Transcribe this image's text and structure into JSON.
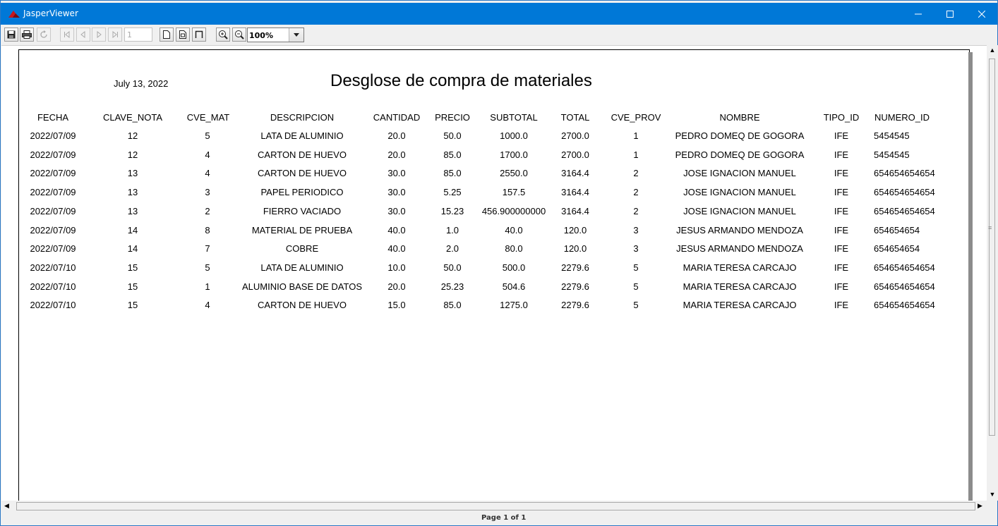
{
  "window": {
    "title": "JasperViewer"
  },
  "toolbar": {
    "page_number": "1",
    "zoom": "100%"
  },
  "report": {
    "date": "July 13, 2022",
    "title": "Desglose de compra de materiales",
    "headers": [
      "FECHA",
      "CLAVE_NOTA",
      "CVE_MAT",
      "DESCRIPCION",
      "CANTIDAD",
      "PRECIO",
      "SUBTOTAL",
      "TOTAL",
      "CVE_PROV",
      "NOMBRE",
      "TIPO_ID",
      "NUMERO_ID"
    ],
    "rows": [
      [
        "2022/07/09",
        "12",
        "5",
        "LATA DE ALUMINIO",
        "20.0",
        "50.0",
        "1000.0",
        "2700.0",
        "1",
        "PEDRO DOMEQ DE GOGORA",
        "IFE",
        "5454545"
      ],
      [
        "2022/07/09",
        "12",
        "4",
        "CARTON DE HUEVO",
        "20.0",
        "85.0",
        "1700.0",
        "2700.0",
        "1",
        "PEDRO DOMEQ DE GOGORA",
        "IFE",
        "5454545"
      ],
      [
        "2022/07/09",
        "13",
        "4",
        "CARTON DE HUEVO",
        "30.0",
        "85.0",
        "2550.0",
        "3164.4",
        "2",
        "JOSE IGNACION MANUEL",
        "IFE",
        "654654654654"
      ],
      [
        "2022/07/09",
        "13",
        "3",
        "PAPEL PERIODICO",
        "30.0",
        "5.25",
        "157.5",
        "3164.4",
        "2",
        "JOSE IGNACION MANUEL",
        "IFE",
        "654654654654"
      ],
      [
        "2022/07/09",
        "13",
        "2",
        "FIERRO VACIADO",
        "30.0",
        "15.23",
        "456.900000000",
        "3164.4",
        "2",
        "JOSE IGNACION MANUEL",
        "IFE",
        "654654654654"
      ],
      [
        "2022/07/09",
        "14",
        "8",
        "MATERIAL DE PRUEBA",
        "40.0",
        "1.0",
        "40.0",
        "120.0",
        "3",
        "JESUS ARMANDO MENDOZA",
        "IFE",
        "654654654"
      ],
      [
        "2022/07/09",
        "14",
        "7",
        "COBRE",
        "40.0",
        "2.0",
        "80.0",
        "120.0",
        "3",
        "JESUS ARMANDO MENDOZA",
        "IFE",
        "654654654"
      ],
      [
        "2022/07/10",
        "15",
        "5",
        "LATA DE ALUMINIO",
        "10.0",
        "50.0",
        "500.0",
        "2279.6",
        "5",
        "MARIA TERESA CARCAJO",
        "IFE",
        "654654654654"
      ],
      [
        "2022/07/10",
        "15",
        "1",
        "ALUMINIO BASE DE DATOS",
        "20.0",
        "25.23",
        "504.6",
        "2279.6",
        "5",
        "MARIA TERESA CARCAJO",
        "IFE",
        "654654654654"
      ],
      [
        "2022/07/10",
        "15",
        "4",
        "CARTON DE HUEVO",
        "15.0",
        "85.0",
        "1275.0",
        "2279.6",
        "5",
        "MARIA TERESA CARCAJO",
        "IFE",
        "654654654654"
      ]
    ]
  },
  "status": {
    "page_info": "Page 1 of 1"
  }
}
